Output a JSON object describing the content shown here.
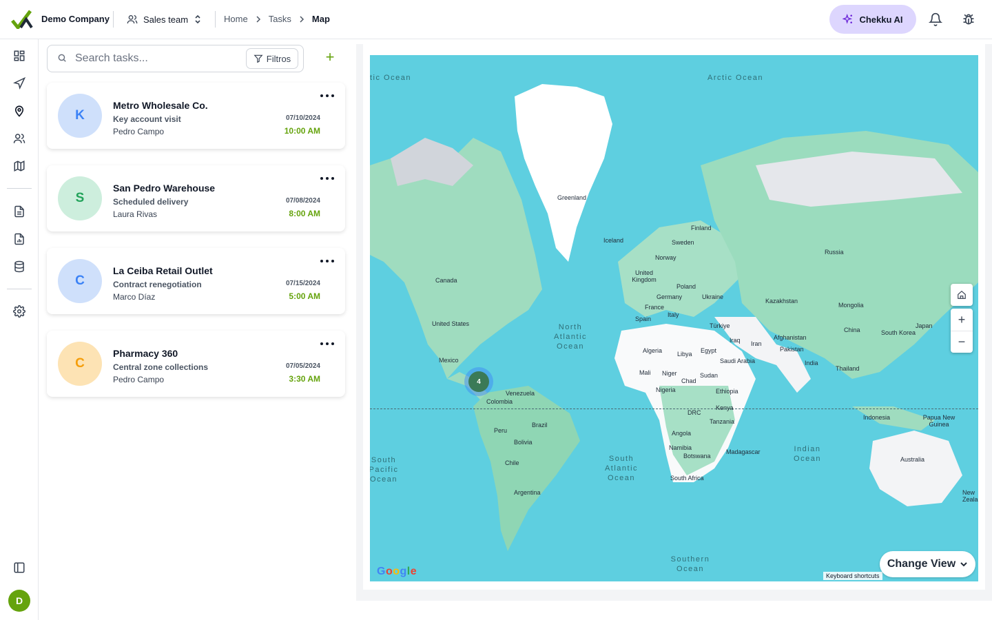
{
  "header": {
    "company": "Demo Company",
    "team": "Sales team",
    "breadcrumbs": [
      "Home",
      "Tasks",
      "Map"
    ],
    "ai_button": "Chekku AI"
  },
  "sidebar": {
    "avatar_initial": "D",
    "items": [
      "dashboard",
      "navigation",
      "location",
      "users",
      "map",
      "documents",
      "reports",
      "database",
      "settings"
    ]
  },
  "tasks": {
    "search_placeholder": "Search tasks...",
    "filter_label": "Filtros",
    "add_label": "+",
    "items": [
      {
        "initial": "K",
        "name": "Metro Wholesale Co.",
        "type": "Key account visit",
        "person": "Pedro Campo",
        "date": "07/10/2024",
        "time": "10:00 AM",
        "avatar_bg": "#cfe0fb",
        "avatar_fg": "#3b82f6"
      },
      {
        "initial": "S",
        "name": "San Pedro Warehouse",
        "type": "Scheduled delivery",
        "person": "Laura Rivas",
        "date": "07/08/2024",
        "time": "8:00 AM",
        "avatar_bg": "#cdeedd",
        "avatar_fg": "#22a35a"
      },
      {
        "initial": "C",
        "name": "La Ceiba Retail Outlet",
        "type": "Contract renegotiation",
        "person": "Marco Díaz",
        "date": "07/15/2024",
        "time": "5:00 AM",
        "avatar_bg": "#cfe0fb",
        "avatar_fg": "#3b82f6"
      },
      {
        "initial": "C",
        "name": "Pharmacy 360",
        "type": "Central zone collections",
        "person": "Pedro Campo",
        "date": "07/05/2024",
        "time": "3:30 AM",
        "avatar_bg": "#fde3b4",
        "avatar_fg": "#f59e0b"
      }
    ]
  },
  "map": {
    "cluster_count": "4",
    "change_view": "Change View",
    "keyboard_shortcuts": "Keyboard shortcuts",
    "brand": "Google",
    "zoom_in": "+",
    "zoom_out": "−",
    "oceans": {
      "arctic_left": "tic Ocean",
      "arctic": "Arctic Ocean",
      "north_atlantic": "North Atlantic Ocean",
      "south_pacific": "South Pacific Ocean",
      "south_atlantic": "South Atlantic Ocean",
      "indian": "Indian Ocean",
      "southern": "Southern Ocean"
    },
    "places": {
      "greenland": "Greenland",
      "iceland": "Iceland",
      "finland": "Finland",
      "sweden": "Sweden",
      "norway": "Norway",
      "uk": "United Kingdom",
      "poland": "Poland",
      "germany": "Germany",
      "ukraine": "Ukraine",
      "france": "France",
      "italy": "Italy",
      "spain": "Spain",
      "russia": "Russia",
      "kazakhstan": "Kazakhstan",
      "mongolia": "Mongolia",
      "china": "China",
      "japan": "Japan",
      "south_korea": "South Korea",
      "turkiye": "Türkiye",
      "iraq": "Iraq",
      "iran": "Iran",
      "afghanistan": "Afghanistan",
      "pakistan": "Pakistan",
      "india": "India",
      "thailand": "Thailand",
      "saudi": "Saudi Arabia",
      "egypt": "Egypt",
      "libya": "Libya",
      "algeria": "Algeria",
      "mali": "Mali",
      "niger": "Niger",
      "chad": "Chad",
      "sudan": "Sudan",
      "nigeria": "Nigeria",
      "ethiopia": "Ethiopia",
      "kenya": "Kenya",
      "drc": "DRC",
      "tanzania": "Tanzania",
      "angola": "Angola",
      "namibia": "Namibia",
      "botswana": "Botswana",
      "madagascar": "Madagascar",
      "south_africa": "South Africa",
      "indonesia": "Indonesia",
      "png": "Papua New Guinea",
      "australia": "Australia",
      "nz": "New Zealand",
      "canada": "Canada",
      "usa": "United States",
      "mexico": "Mexico",
      "venezuela": "Venezuela",
      "colombia": "Colombia",
      "peru": "Peru",
      "brazil": "Brazil",
      "bolivia": "Bolivia",
      "chile": "Chile",
      "argentina": "Argentina"
    }
  }
}
